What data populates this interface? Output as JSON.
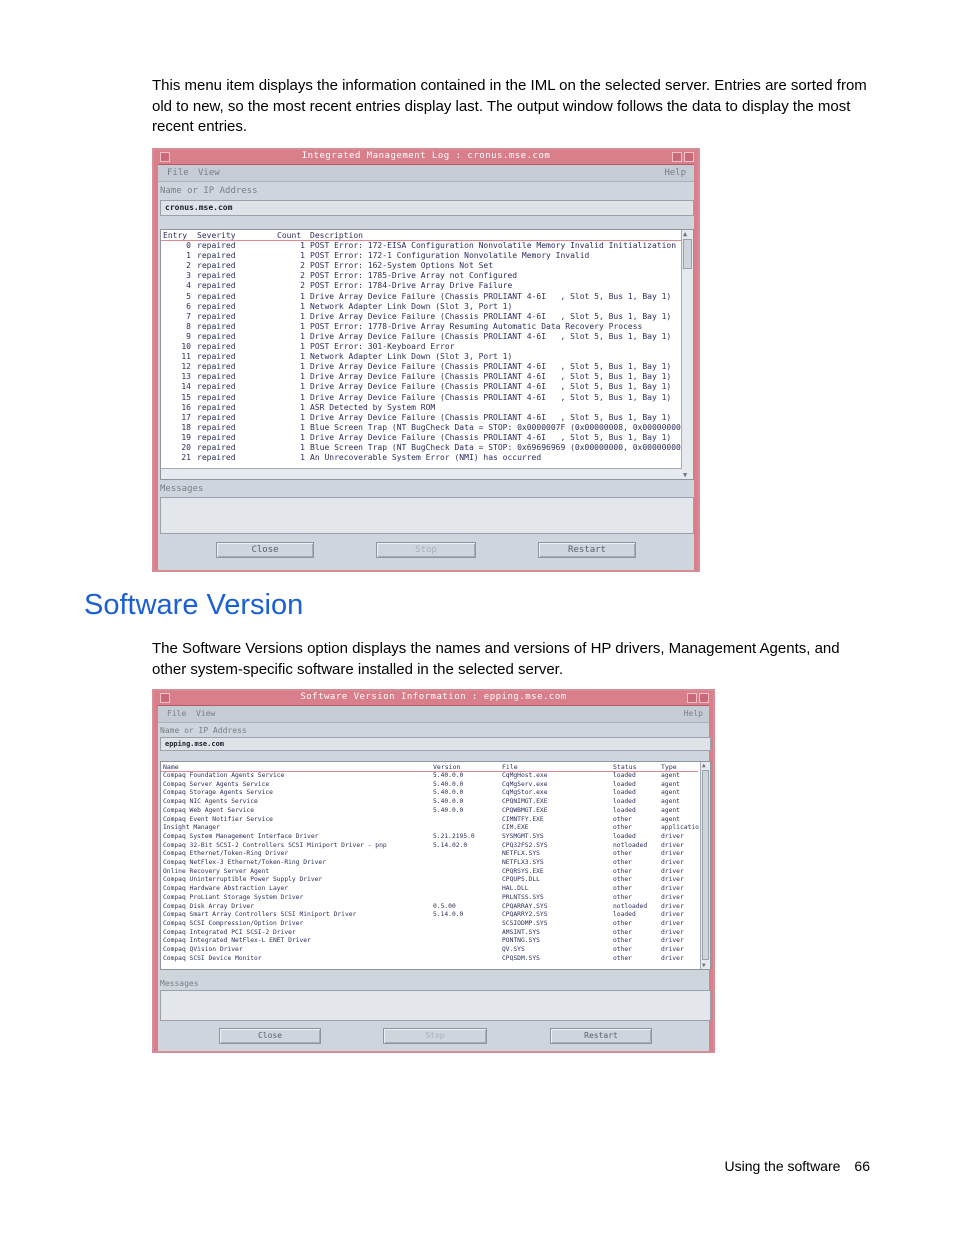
{
  "intro_paragraph": "This menu item displays the information contained in the IML on the selected server. Entries are sorted from old to new, so the most recent entries display last. The output window follows the data to display the most recent entries.",
  "section_heading": "Software Version",
  "section_paragraph": "The Software Versions option displays the names and versions of HP drivers, Management Agents, and other system-specific software installed in the selected server.",
  "footer": {
    "label": "Using the software",
    "page_number": "66"
  },
  "iml_window": {
    "title": "Integrated Management Log : cronus.mse.com",
    "menu_file": "File",
    "menu_view": "View",
    "menu_help": "Help",
    "address_label": "Name or IP Address",
    "address_value": "cronus.mse.com",
    "columns": {
      "entry": "Entry",
      "severity": "Severity",
      "count": "Count",
      "description": "Description"
    },
    "rows": [
      [
        "0",
        "repaired",
        "1",
        "POST Error: 172-EISA Configuration Nonvolatile Memory Invalid Initialization Al"
      ],
      [
        "1",
        "repaired",
        "1",
        "POST Error: 172-1 Configuration Nonvolatile Memory Invalid"
      ],
      [
        "2",
        "repaired",
        "2",
        "POST Error: 162-System Options Not Set"
      ],
      [
        "3",
        "repaired",
        "2",
        "POST Error: 1785-Drive Array not Configured"
      ],
      [
        "4",
        "repaired",
        "2",
        "POST Error: 1784-Drive Array Drive Failure"
      ],
      [
        "5",
        "repaired",
        "1",
        "Drive Array Device Failure (Chassis PROLIANT 4-6I   , Slot 5, Bus 1, Bay 1)"
      ],
      [
        "6",
        "repaired",
        "1",
        "Network Adapter Link Down (Slot 3, Port 1)"
      ],
      [
        "7",
        "repaired",
        "1",
        "Drive Array Device Failure (Chassis PROLIANT 4-6I   , Slot 5, Bus 1, Bay 1)"
      ],
      [
        "8",
        "repaired",
        "1",
        "POST Error: 1778-Drive Array Resuming Automatic Data Recovery Process"
      ],
      [
        "9",
        "repaired",
        "1",
        "Drive Array Device Failure (Chassis PROLIANT 4-6I   , Slot 5, Bus 1, Bay 1)"
      ],
      [
        "10",
        "repaired",
        "1",
        "POST Error: 301-Keyboard Error"
      ],
      [
        "11",
        "repaired",
        "1",
        "Network Adapter Link Down (Slot 3, Port 1)"
      ],
      [
        "12",
        "repaired",
        "1",
        "Drive Array Device Failure (Chassis PROLIANT 4-6I   , Slot 5, Bus 1, Bay 1)"
      ],
      [
        "13",
        "repaired",
        "1",
        "Drive Array Device Failure (Chassis PROLIANT 4-6I   , Slot 5, Bus 1, Bay 1)"
      ],
      [
        "14",
        "repaired",
        "1",
        "Drive Array Device Failure (Chassis PROLIANT 4-6I   , Slot 5, Bus 1, Bay 1)"
      ],
      [
        "15",
        "repaired",
        "1",
        "Drive Array Device Failure (Chassis PROLIANT 4-6I   , Slot 5, Bus 1, Bay 1)"
      ],
      [
        "16",
        "repaired",
        "1",
        "ASR Detected by System ROM"
      ],
      [
        "17",
        "repaired",
        "1",
        "Drive Array Device Failure (Chassis PROLIANT 4-6I   , Slot 5, Bus 1, Bay 1)"
      ],
      [
        "18",
        "repaired",
        "1",
        "Blue Screen Trap (NT BugCheck Data = STOP: 0x0000007F (0x00000008, 0x00000000,"
      ],
      [
        "19",
        "repaired",
        "1",
        "Drive Array Device Failure (Chassis PROLIANT 4-6I   , Slot 5, Bus 1, Bay 1)"
      ],
      [
        "20",
        "repaired",
        "1",
        "Blue Screen Trap (NT BugCheck Data = STOP: 0x69696969 (0x00000000, 0x00000000,"
      ],
      [
        "21",
        "repaired",
        "1",
        "An Unrecoverable System Error (NMI) has occurred"
      ]
    ],
    "messages_label": "Messages",
    "buttons": {
      "close": "Close",
      "stop": "Stop",
      "restart": "Restart"
    }
  },
  "sv_window": {
    "title": "Software Version Information : epping.mse.com",
    "menu_file": "File",
    "menu_view": "View",
    "menu_help": "Help",
    "address_label": "Name or IP Address",
    "address_value": "epping.mse.com",
    "columns": {
      "name": "Name",
      "version": "Version",
      "file": "File",
      "status": "Status",
      "type": "Type"
    },
    "rows": [
      [
        "Compaq Foundation Agents Service",
        "5.40.0.0",
        "CqMgHost.exe",
        "loaded",
        "agent"
      ],
      [
        "Compaq Server Agents Service",
        "5.40.0.0",
        "CqMgServ.exe",
        "loaded",
        "agent"
      ],
      [
        "Compaq Storage Agents Service",
        "5.40.0.0",
        "CqMgStor.exe",
        "loaded",
        "agent"
      ],
      [
        "Compaq NIC Agents Service",
        "5.40.0.0",
        "CPQNIMGT.EXE",
        "loaded",
        "agent"
      ],
      [
        "Compaq Web Agent Service",
        "5.40.0.0",
        "CPQWBMGT.EXE",
        "loaded",
        "agent"
      ],
      [
        "Compaq Event Notifier Service",
        "",
        "CIMNTFY.EXE",
        "other",
        "agent"
      ],
      [
        "Insight Manager",
        "",
        "CIM.EXE",
        "other",
        "applicatio"
      ],
      [
        "Compaq System Management Interface Driver",
        "5.21.2195.0",
        "SYSMGMT.SYS",
        "loaded",
        "driver"
      ],
      [
        "Compaq 32-Bit SCSI-2 Controllers SCSI Miniport Driver - pnp",
        "5.14.02.0",
        "CPQ32FS2.SYS",
        "notloaded",
        "driver"
      ],
      [
        "Compaq Ethernet/Token-Ring Driver",
        "",
        "NETFLX.SYS",
        "other",
        "driver"
      ],
      [
        "Compaq NetFlex-3 Ethernet/Token-Ring Driver",
        "",
        "NETFLX3.SYS",
        "other",
        "driver"
      ],
      [
        "Online Recovery Server Agent",
        "",
        "CPQRSYS.EXE",
        "other",
        "driver"
      ],
      [
        "Compaq Uninterruptible Power Supply Driver",
        "",
        "CPQUPS.DLL",
        "other",
        "driver"
      ],
      [
        "Compaq Hardware Abstraction Layer",
        "",
        "HAL.DLL",
        "other",
        "driver"
      ],
      [
        "Compaq ProLiant Storage System Driver",
        "",
        "PRLNTSS.SYS",
        "other",
        "driver"
      ],
      [
        "Compaq Disk Array Driver",
        "0.5.00",
        "CPQARRAY.SYS",
        "notloaded",
        "driver"
      ],
      [
        "Compaq Smart Array Controllers SCSI Miniport Driver",
        "5.14.0.0",
        "CPQARRY2.SYS",
        "loaded",
        "driver"
      ],
      [
        "Compaq SCSI Compression/Option Driver",
        "",
        "SCSIODMP.SYS",
        "other",
        "driver"
      ],
      [
        "Compaq Integrated PCI SCSI-2 Driver",
        "",
        "AMSINT.SYS",
        "other",
        "driver"
      ],
      [
        "Compaq Integrated NetFlex-L ENET Driver",
        "",
        "PONTNG.SYS",
        "other",
        "driver"
      ],
      [
        "Compaq QVision Driver",
        "",
        "QV.SYS",
        "other",
        "driver"
      ],
      [
        "Compaq SCSI Device Monitor",
        "",
        "CPQSDM.SYS",
        "other",
        "driver"
      ]
    ],
    "messages_label": "Messages",
    "buttons": {
      "close": "Close",
      "stop": "Stop",
      "restart": "Restart"
    }
  }
}
